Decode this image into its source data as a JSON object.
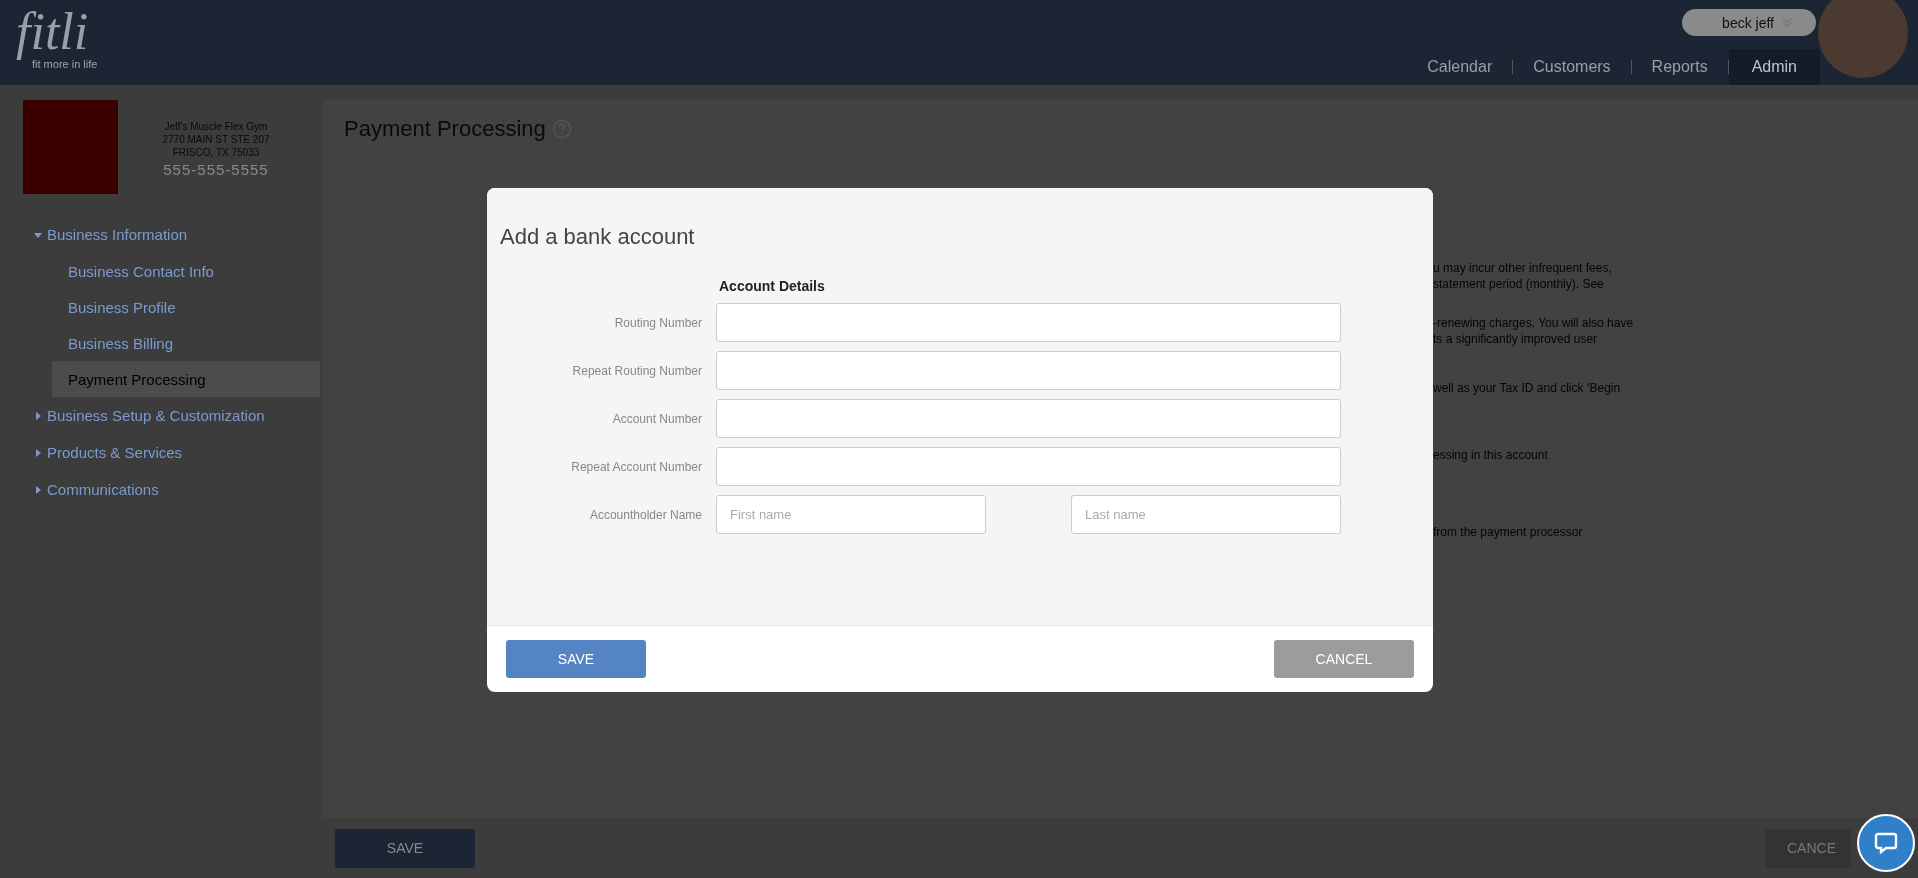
{
  "header": {
    "logo_text": "fitli",
    "logo_tagline": "fit more in life",
    "user_name": "beck jeff",
    "nav": [
      {
        "label": "Calendar",
        "selected": false
      },
      {
        "label": "Customers",
        "selected": false
      },
      {
        "label": "Reports",
        "selected": false
      },
      {
        "label": "Admin",
        "selected": true
      }
    ]
  },
  "sidebar": {
    "business": {
      "name": "Jeff's Muscle Flex Gym",
      "address_line_1": "2770 MAIN ST STE 207",
      "address_line_2": "FRISCO, TX 75033",
      "phone": "555-555-5555"
    },
    "tree": [
      {
        "label": "Business Information",
        "expanded": true,
        "children": [
          {
            "label": "Business Contact Info",
            "selected": false
          },
          {
            "label": "Business Profile",
            "selected": false
          },
          {
            "label": "Business Billing",
            "selected": false
          },
          {
            "label": "Payment Processing",
            "selected": true
          }
        ]
      },
      {
        "label": "Business Setup & Customization",
        "expanded": false
      },
      {
        "label": "Products & Services",
        "expanded": false
      },
      {
        "label": "Communications",
        "expanded": false
      }
    ]
  },
  "page": {
    "title": "Payment Processing",
    "background_text": [
      [
        "u may incur other infrequent fees,",
        "statement period (monthly). See"
      ],
      [
        "-renewing charges. You will also have",
        "ts a significantly improved user"
      ],
      [
        "well as your Tax ID and click ‘Begin"
      ],
      [
        "essing in this account"
      ],
      [
        "from the payment processor"
      ]
    ],
    "save_button": "SAVE",
    "cancel_button": "CANCE"
  },
  "modal": {
    "title": "Add a bank account",
    "section_heading": "Account Details",
    "fields": [
      {
        "kind": "single",
        "label": "Routing Number"
      },
      {
        "kind": "single",
        "label": "Repeat Routing Number"
      },
      {
        "kind": "single",
        "label": "Account Number"
      },
      {
        "kind": "single",
        "label": "Repeat Account Number"
      },
      {
        "kind": "name",
        "label": "Accountholder Name",
        "placeholders": [
          "First name",
          "Last name"
        ]
      }
    ],
    "save_button": "SAVE",
    "cancel_button": "CANCEL"
  }
}
